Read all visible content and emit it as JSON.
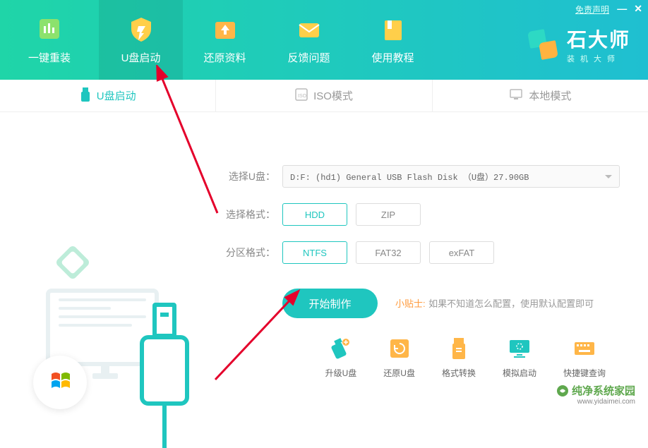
{
  "header": {
    "disclaimer": "免责声明",
    "nav": [
      {
        "label": "一键重装"
      },
      {
        "label": "U盘启动"
      },
      {
        "label": "还原资料"
      },
      {
        "label": "反馈问题"
      },
      {
        "label": "使用教程"
      }
    ],
    "brand_title": "石大师",
    "brand_sub": "装机大师"
  },
  "subtabs": [
    {
      "label": "U盘启动",
      "active": true
    },
    {
      "label": "ISO模式",
      "active": false
    },
    {
      "label": "本地模式",
      "active": false
    }
  ],
  "form": {
    "drive_label": "选择U盘：",
    "drive_value": "D:F: (hd1) General USB Flash Disk （U盘）27.90GB",
    "format_label": "选择格式：",
    "format_options": [
      "HDD",
      "ZIP"
    ],
    "format_selected_index": 0,
    "partition_label": "分区格式：",
    "partition_options": [
      "NTFS",
      "FAT32",
      "exFAT"
    ],
    "partition_selected_index": 0,
    "start_button": "开始制作",
    "tip_label": "小贴士:",
    "tip_text": "如果不知道怎么配置，使用默认配置即可"
  },
  "bottom_tools": [
    {
      "label": "升级U盘"
    },
    {
      "label": "还原U盘"
    },
    {
      "label": "格式转换"
    },
    {
      "label": "模拟启动"
    },
    {
      "label": "快捷键查询"
    }
  ],
  "watermark": {
    "line1": "纯净系统家园",
    "line2": "www.yidaimei.com"
  }
}
